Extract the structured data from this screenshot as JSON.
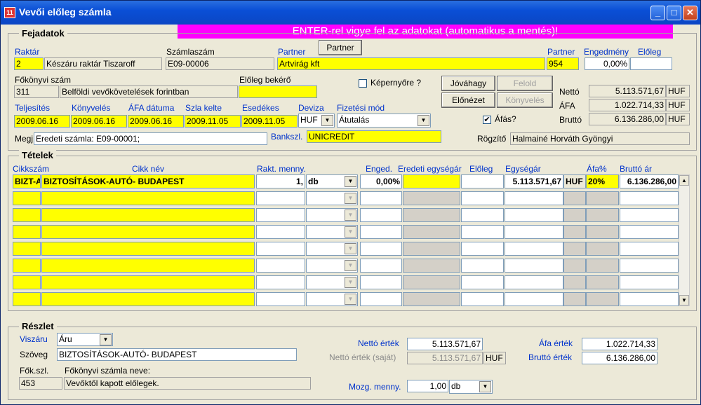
{
  "window": {
    "title": "Vevői előleg számla",
    "icon": "app-icon"
  },
  "banner": "ENTER-rel vigye fel az adatokat (automatikus a mentés)!",
  "header": {
    "group_label": "Fejadatok",
    "raktar": {
      "label": "Raktár",
      "code": "2",
      "name": "Készáru raktár Tiszaroff"
    },
    "szamlaszam": {
      "label": "Számlaszám",
      "value": "E09-00006"
    },
    "partner": {
      "label": "Partner",
      "button": "Partner",
      "name": "Artvirág kft",
      "code_label": "Partner",
      "code": "954"
    },
    "engedmeny": {
      "label": "Engedmény",
      "value": "0,00%"
    },
    "eloleg": {
      "label": "Előleg",
      "value": ""
    },
    "fokonyvi": {
      "label": "Főkönyvi szám",
      "code": "311",
      "name": "Belföldi vevőkövetelések forintban"
    },
    "eloleg_bekero": {
      "label": "Előleg bekérő",
      "value": ""
    },
    "kepernyore": {
      "label": "Képernyőre ?",
      "checked": false
    },
    "buttons": {
      "jovahagy": "Jóváhagy",
      "felold": "Felold",
      "elonezet": "Előnézet",
      "konyveles": "Könyvelés"
    },
    "afas": {
      "label": "Áfás?",
      "checked": true
    },
    "dates": {
      "teljesites": {
        "label": "Teljesítés",
        "value": "2009.06.16"
      },
      "konyveles": {
        "label": "Könyvelés",
        "value": "2009.06.16"
      },
      "afa_datum": {
        "label": "ÁFA dátuma",
        "value": "2009.06.16"
      },
      "szla_kelte": {
        "label": "Szla kelte",
        "value": "2009.11.05"
      },
      "esedekes": {
        "label": "Esedékes",
        "value": "2009.11.05"
      }
    },
    "deviza": {
      "label": "Deviza",
      "value": "HUF"
    },
    "fizetesi_mod": {
      "label": "Fizetési mód",
      "value": "Átutalás"
    },
    "totals": {
      "netto_label": "Nettó",
      "netto": "5.113.571,67",
      "afa_label": "ÁFA",
      "afa": "1.022.714,33",
      "brutto_label": "Bruttó",
      "brutto": "6.136.286,00",
      "currency": "HUF"
    },
    "megj": {
      "label": "Megj",
      "value": "Eredeti számla: E09-00001;"
    },
    "bankszl": {
      "label": "Bankszl.",
      "value": "UNICREDIT"
    },
    "rogzito": {
      "label": "Rögzítő",
      "value": "Halmainé Horváth Gyöngyi"
    }
  },
  "items": {
    "group_label": "Tételek",
    "columns": {
      "cikkszam": "Cikkszám",
      "cikk_nev": "Cikk név",
      "rakt_menny": "Rakt. menny.",
      "enged": "Enged.",
      "eredeti": "Eredeti egységár",
      "eloleg": "Előleg",
      "egysegar": "Egységár",
      "afa_pct": "Áfa%",
      "brutto_ar": "Bruttó ár"
    },
    "row": {
      "cikkszam": "BIZT-A",
      "cikk_nev": "BIZTOSÍTÁSOK-AUTÓ- BUDAPEST",
      "menny": "1,",
      "unit": "db",
      "enged": "0,00%",
      "eredeti": "",
      "eloleg": "",
      "egysegar": "5.113.571,67",
      "currency": "HUF",
      "afa_pct": "20%",
      "brutto": "6.136.286,00"
    }
  },
  "detail": {
    "group_label": "Részlet",
    "viszaru": {
      "label": "Viszáru",
      "value": "Áru"
    },
    "szoveg": {
      "label": "Szöveg",
      "value": "BIZTOSÍTÁSOK-AUTÓ- BUDAPEST"
    },
    "fok_szl": {
      "label": "Fők.szl.",
      "value": "453"
    },
    "fokonyvi_nev": {
      "label": "Főkönyvi számla neve:",
      "value": "Vevőktől kapott előlegek."
    },
    "netto_ertek": {
      "label": "Nettó érték",
      "value": "5.113.571,67"
    },
    "netto_sajat": {
      "label": "Nettó érték (saját)",
      "value": "5.113.571,67",
      "currency": "HUF"
    },
    "mozg_menny": {
      "label": "Mozg. menny.",
      "value": "1,00",
      "unit": "db"
    },
    "afa_ertek": {
      "label": "Áfa érték",
      "value": "1.022.714,33"
    },
    "brutto_ertek": {
      "label": "Bruttó érték",
      "value": "6.136.286,00"
    }
  }
}
